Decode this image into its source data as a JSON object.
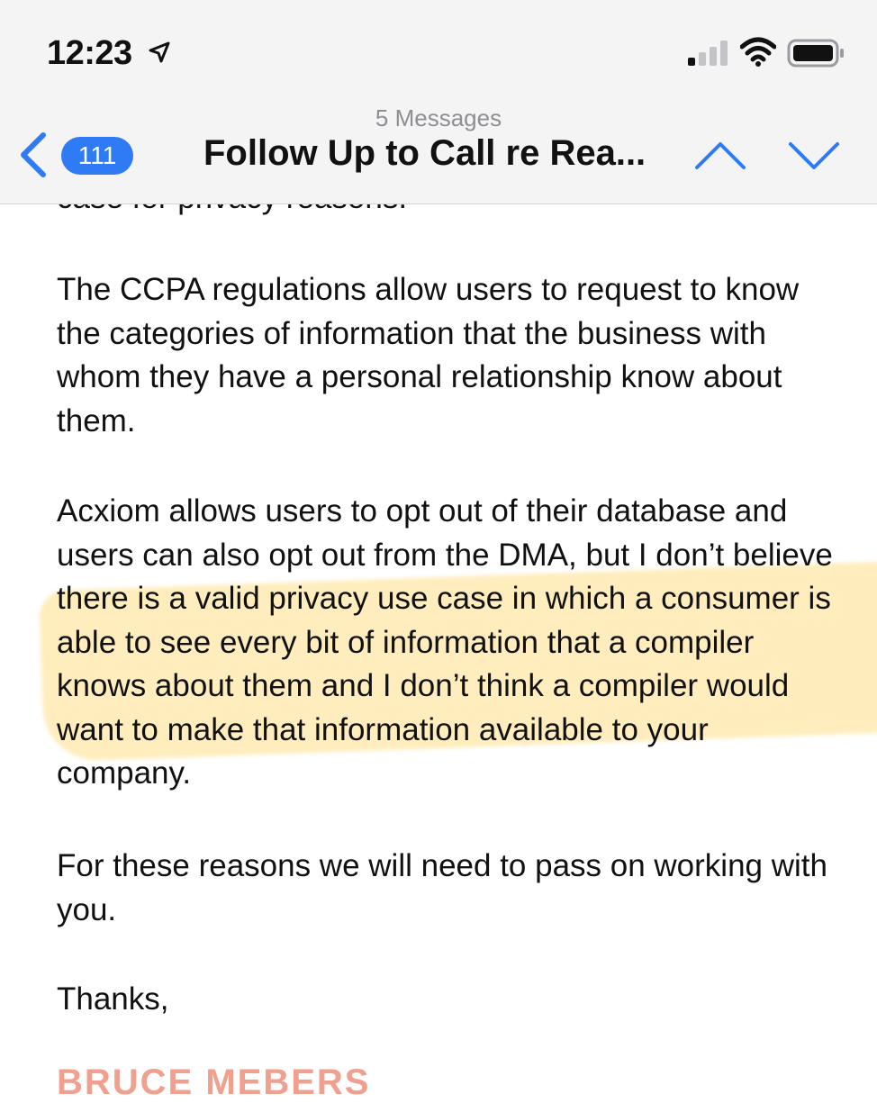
{
  "status_bar": {
    "time": "12:23"
  },
  "nav": {
    "subtitle": "5 Messages",
    "unread_badge": "111",
    "title": "Follow Up to Call re Rea..."
  },
  "email": {
    "cut_line": "case for privacy reasons.",
    "paragraphs": [
      "The CCPA regulations allow users to request to know the categories of information that the business with whom they have a personal relationship know about them.",
      "Acxiom allows users to opt out of their database and users can also opt out from the DMA, but I don’t believe there is a valid privacy use case in which a consumer is able to see every bit of information that a compiler knows about them and I don’t think a compiler would want to make that information available to your company.",
      "For these reasons we will need to pass on working with you.",
      "Thanks,"
    ],
    "signature": "BRUCE MEBERS"
  },
  "colors": {
    "accent": "#2f7bf5",
    "highlight": "#ffd66e",
    "signature": "#f0a08e"
  },
  "icons": [
    "location-arrow-icon",
    "cellular-signal-icon",
    "wifi-icon",
    "battery-icon",
    "chevron-left-icon",
    "chevron-up-icon",
    "chevron-down-icon"
  ]
}
